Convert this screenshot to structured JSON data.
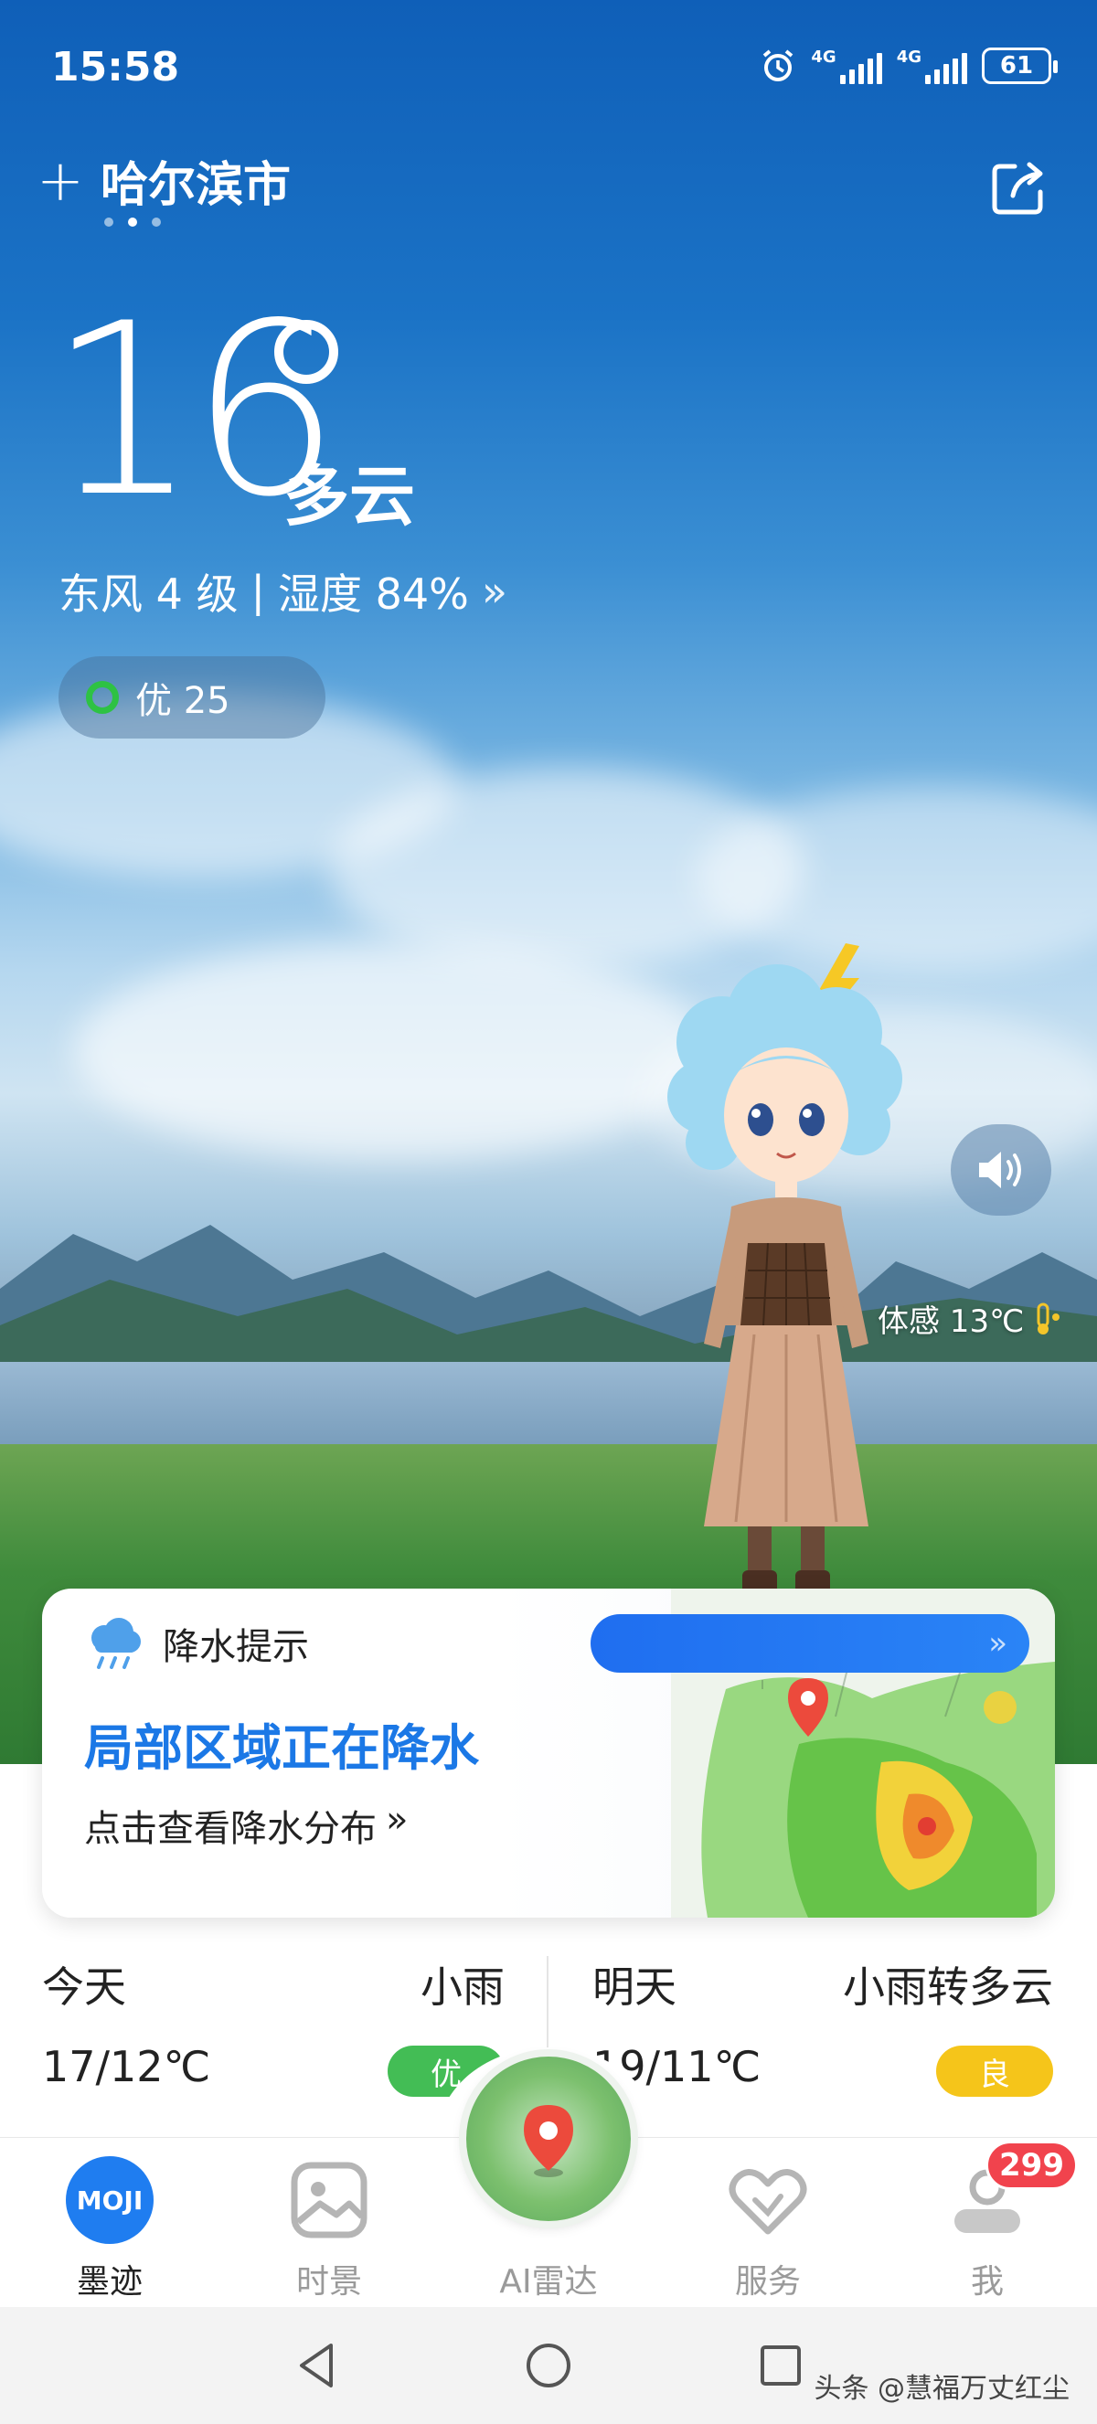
{
  "status_bar": {
    "time": "15:58",
    "signal_1_label": "4G",
    "signal_2_label": "4G",
    "battery": "61"
  },
  "header": {
    "add_icon": "plus-icon",
    "city": "哈尔滨市",
    "page_dots": 3,
    "active_dot": 2,
    "share_icon": "share-icon"
  },
  "current": {
    "temperature": "16",
    "condition": "多云",
    "wind": "东风 4 级",
    "separator": "|",
    "humidity": "湿度 84%",
    "more": "»",
    "aqi_label": "优 25",
    "aqi_color": "#2ec244",
    "feels_like": "体感 13℃"
  },
  "rain_card": {
    "header": "降水提示",
    "title": "局部区域正在降水",
    "subtitle": "点击查看降水分布",
    "more": "»",
    "pill_chevron": "»"
  },
  "forecast": {
    "today": {
      "day": "今天",
      "condition": "小雨",
      "temp": "17/12℃",
      "aqi": "优",
      "aqi_color": "#43bd55"
    },
    "tomorrow": {
      "day": "明天",
      "condition": "小雨转多云",
      "temp": "19/11℃",
      "aqi": "良",
      "aqi_color": "#f5c51a"
    }
  },
  "tabbar": {
    "tabs": [
      {
        "label": "墨迹",
        "icon": "moji-logo-icon"
      },
      {
        "label": "时景",
        "icon": "picture-icon"
      },
      {
        "label": "AI雷达",
        "icon": "radar-icon"
      },
      {
        "label": "服务",
        "icon": "handshake-icon"
      },
      {
        "label": "我",
        "icon": "profile-icon"
      }
    ],
    "me_badge": "299",
    "logo_text": "MOJI"
  },
  "watermark": "头条 @慧福万丈红尘",
  "colors": {
    "accent_blue": "#1b78e6",
    "badge_red": "#f1434d"
  }
}
